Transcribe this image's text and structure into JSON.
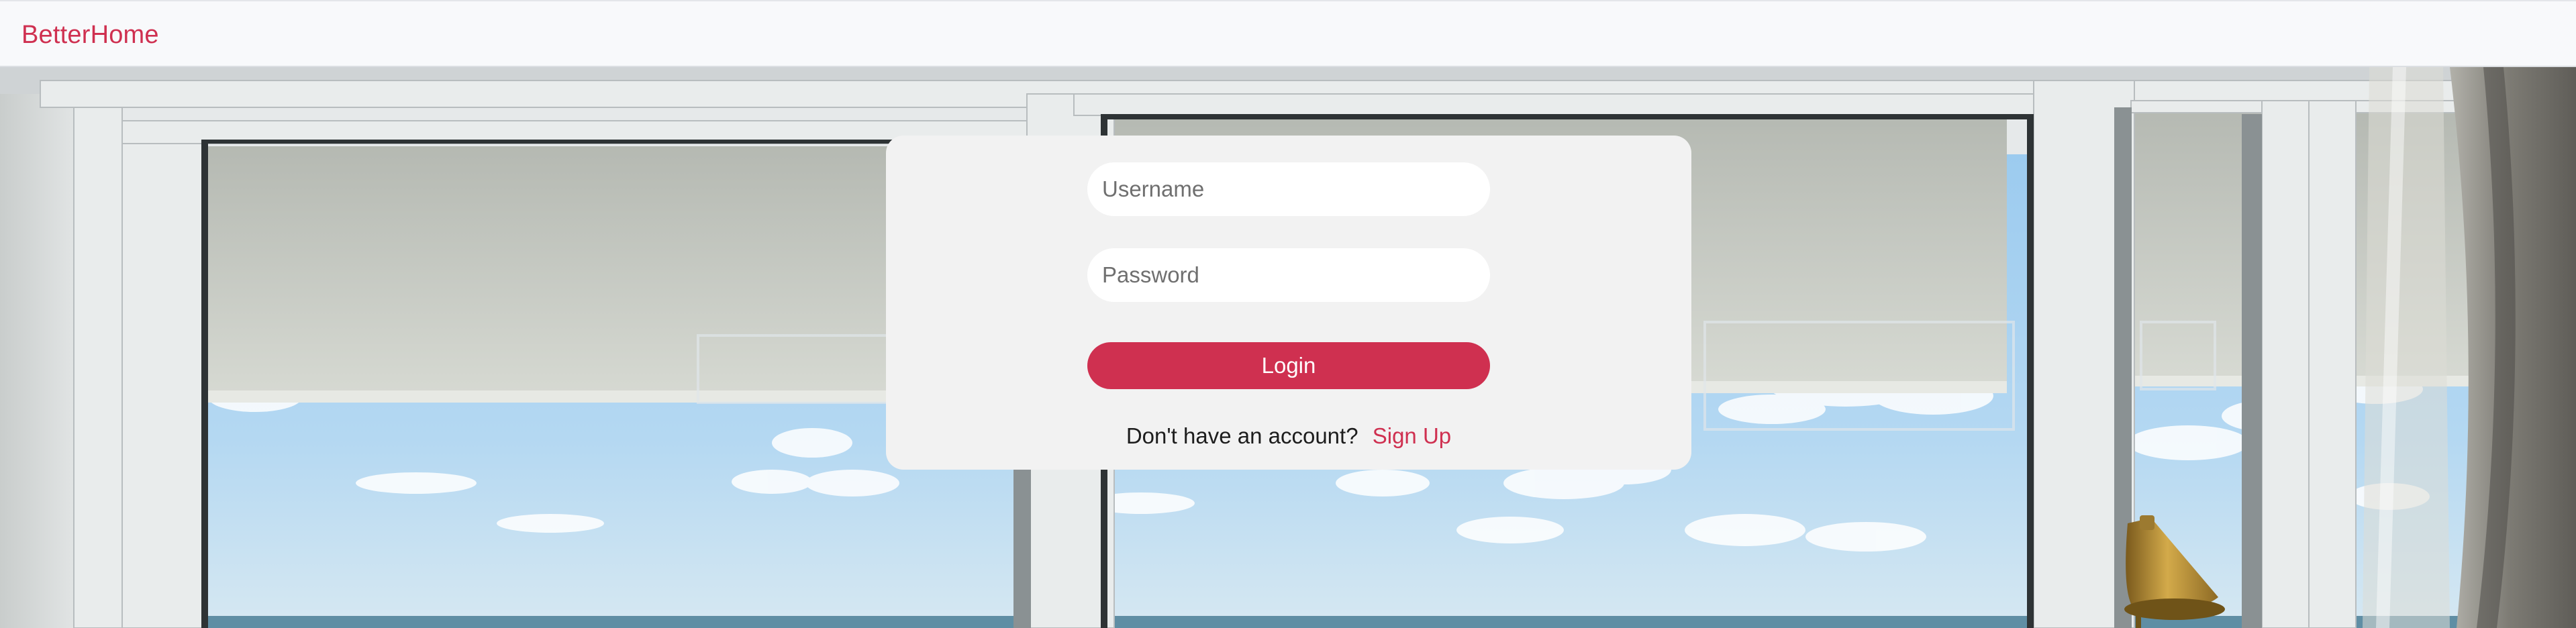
{
  "navbar": {
    "brand": "BetterHome"
  },
  "login_form": {
    "username_placeholder": "Username",
    "username_value": "",
    "password_placeholder": "Password",
    "password_value": "",
    "login_label": "Login",
    "signup_prompt": "Don't have an account?",
    "signup_link": "Sign Up"
  },
  "colors": {
    "accent": "#cf3050",
    "navbar_bg": "#f8f9fb",
    "card_bg": "#f2f2f2"
  }
}
